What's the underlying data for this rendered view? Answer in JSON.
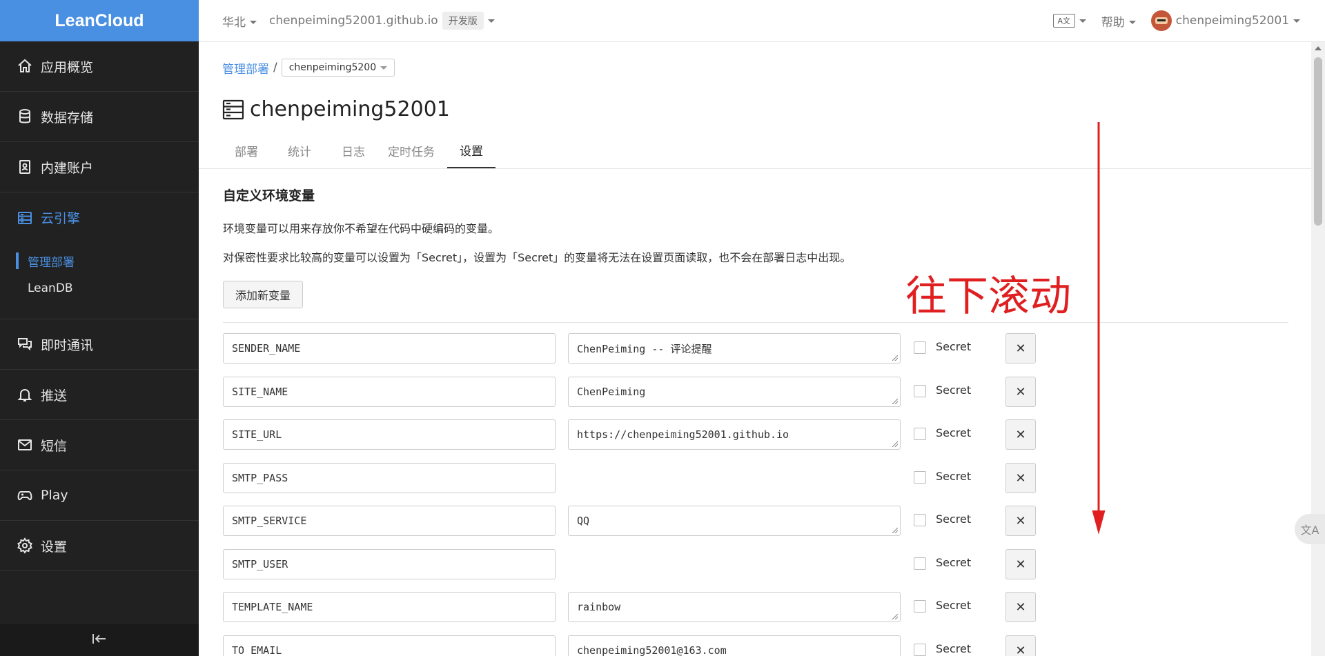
{
  "sidebar": {
    "logo": "LeanCloud",
    "items": [
      {
        "label": "应用概览",
        "icon": "home-icon"
      },
      {
        "label": "数据存储",
        "icon": "database-icon"
      },
      {
        "label": "内建账户",
        "icon": "user-badge-icon"
      },
      {
        "label": "云引擎",
        "icon": "server-icon"
      },
      {
        "label": "即时通讯",
        "icon": "chat-icon"
      },
      {
        "label": "推送",
        "icon": "bell-icon"
      },
      {
        "label": "短信",
        "icon": "mail-icon"
      },
      {
        "label": "Play",
        "icon": "gamepad-icon"
      },
      {
        "label": "设置",
        "icon": "gear-icon"
      }
    ],
    "sub_items": [
      {
        "label": "管理部署"
      },
      {
        "label": "LeanDB"
      }
    ],
    "collapse_icon": "collapse-left-icon"
  },
  "topbar": {
    "region": "华北",
    "app": "chenpeiming52001.github.io",
    "plan_badge": "开发版",
    "help": "帮助",
    "user": "chenpeiming52001",
    "lang_icon_text": "A文"
  },
  "breadcrumb": {
    "root": "管理部署",
    "separator": "/",
    "current": "chenpeiming5200"
  },
  "page": {
    "title": "chenpeiming52001",
    "tabs": [
      "部署",
      "统计",
      "日志",
      "定时任务",
      "设置"
    ],
    "active_tab": "设置"
  },
  "env": {
    "section_title": "自定义环境变量",
    "desc1": "环境变量可以用来存放你不希望在代码中硬编码的变量。",
    "desc2": "对保密性要求比较高的变量可以设置为「Secret」，设置为「Secret」的变量将无法在设置页面读取，也不会在部署日志中出现。",
    "add_button": "添加新变量",
    "secret_label": "Secret",
    "delete_symbol": "✕",
    "variables": [
      {
        "name": "SENDER_NAME",
        "value": "ChenPeiming -- 评论提醒"
      },
      {
        "name": "SITE_NAME",
        "value": "ChenPeiming"
      },
      {
        "name": "SITE_URL",
        "value": "https://chenpeiming52001.github.io"
      },
      {
        "name": "SMTP_PASS",
        "value": ""
      },
      {
        "name": "SMTP_SERVICE",
        "value": "QQ"
      },
      {
        "name": "SMTP_USER",
        "value": ""
      },
      {
        "name": "TEMPLATE_NAME",
        "value": "rainbow"
      },
      {
        "name": "TO_EMAIL",
        "value": "chenpeiming52001@163.com"
      }
    ]
  },
  "annotation": {
    "text": "往下滚动",
    "color": "#e02020"
  },
  "translate_fab": "文A",
  "colors": {
    "accent": "#4a90e2",
    "sidebar_bg": "#212121",
    "annotation": "#e02020"
  }
}
